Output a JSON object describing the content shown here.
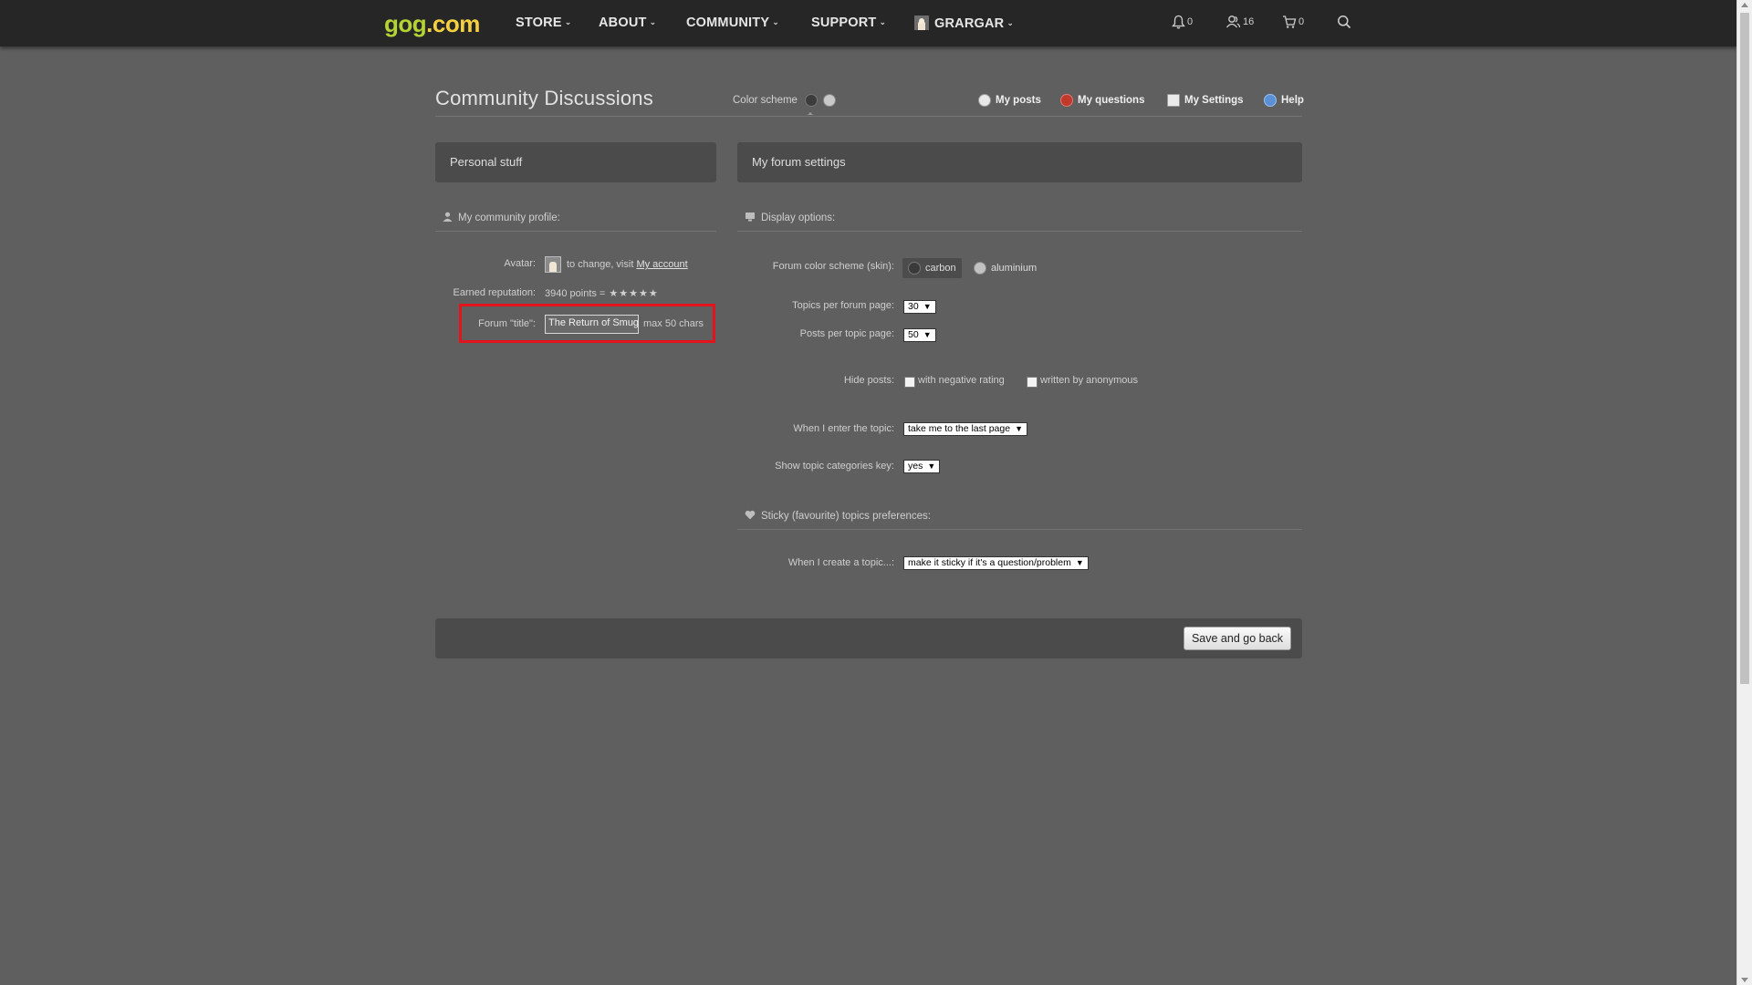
{
  "nav": {
    "logo_part1": "gog",
    "logo_part2": ".com",
    "items": [
      "STORE",
      "ABOUT",
      "COMMUNITY",
      "SUPPORT"
    ],
    "username": "GRARGAR",
    "notifications_count": "0",
    "friends_count": "16",
    "cart_count": "0"
  },
  "header": {
    "title": "Community Discussions",
    "color_scheme_label": "Color scheme",
    "links": [
      "My posts",
      "My questions",
      "My Settings",
      "Help"
    ]
  },
  "left_panel": {
    "heading": "Personal stuff",
    "section_title": "My community profile:",
    "avatar_label": "Avatar:",
    "avatar_text": "to change, visit",
    "avatar_link": "My account",
    "reputation_label": "Earned reputation:",
    "reputation_value": "3940 points =",
    "reputation_stars": "★★★★★",
    "forum_title_label": "Forum \"title\":",
    "forum_title_value": "The Return of Smug",
    "forum_title_hint": "max 50 chars"
  },
  "right_panel": {
    "heading": "My forum settings",
    "display_section_title": "Display options:",
    "skin_label": "Forum color scheme (skin):",
    "skin_options": [
      "carbon",
      "aluminium"
    ],
    "skin_selected": "carbon",
    "topics_per_page_label": "Topics per forum page:",
    "topics_per_page_value": "30",
    "posts_per_page_label": "Posts per topic page:",
    "posts_per_page_value": "50",
    "hide_posts_label": "Hide posts:",
    "hide_options": [
      "with negative rating",
      "written by anonymous"
    ],
    "enter_topic_label": "When I enter the topic:",
    "enter_topic_value": "take me to the last page",
    "categories_key_label": "Show topic categories key:",
    "categories_key_value": "yes",
    "sticky_section_title": "Sticky (favourite) topics preferences:",
    "create_topic_label": "When I create a topic...:",
    "create_topic_value": "make it sticky if it's a question/problem"
  },
  "footer": {
    "save_label": "Save and go back"
  },
  "colors": {
    "background": "#5f5f5f",
    "topbar": "#262626",
    "panel": "#4b4b4b",
    "highlight": "#e3141c",
    "logo_green": "#b5d334"
  }
}
